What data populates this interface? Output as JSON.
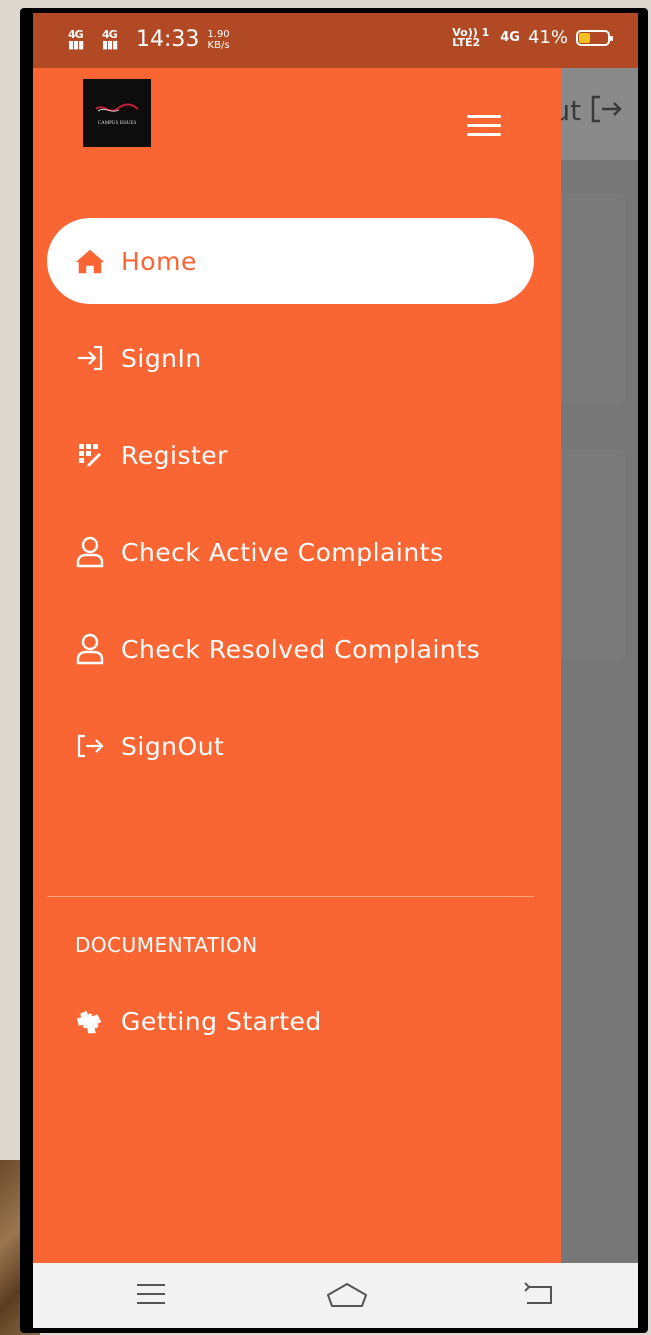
{
  "status_bar": {
    "signal_label": "4G",
    "time": "14:33",
    "net_speed_value": "1.90",
    "net_speed_unit": "KB/s",
    "volte": "Vo)) 1 LTE2",
    "network_type": "4G",
    "battery_percent": "41%",
    "battery_level": 0.41,
    "battery_color": "#f2c020"
  },
  "app": {
    "logo_text": "CAMPUS ISSUES",
    "background_header_text": "ut"
  },
  "drawer": {
    "color": "#f96533",
    "menu_icon": "hamburger-icon",
    "items": [
      {
        "label": "Home",
        "icon": "home-icon",
        "active": true
      },
      {
        "label": "SignIn",
        "icon": "sign-in-icon",
        "active": false
      },
      {
        "label": "Register",
        "icon": "register-icon",
        "active": false
      },
      {
        "label": "Check Active Complaints",
        "icon": "user-icon",
        "active": false
      },
      {
        "label": "Check Resolved Complaints",
        "icon": "user-icon",
        "active": false
      },
      {
        "label": "SignOut",
        "icon": "sign-out-icon",
        "active": false
      }
    ],
    "section_heading": "DOCUMENTATION",
    "documentation_items": [
      {
        "label": "Getting Started",
        "icon": "puzzle-icon"
      }
    ]
  },
  "system_nav": {
    "icons": [
      "menu-icon",
      "home-icon",
      "back-icon"
    ]
  }
}
